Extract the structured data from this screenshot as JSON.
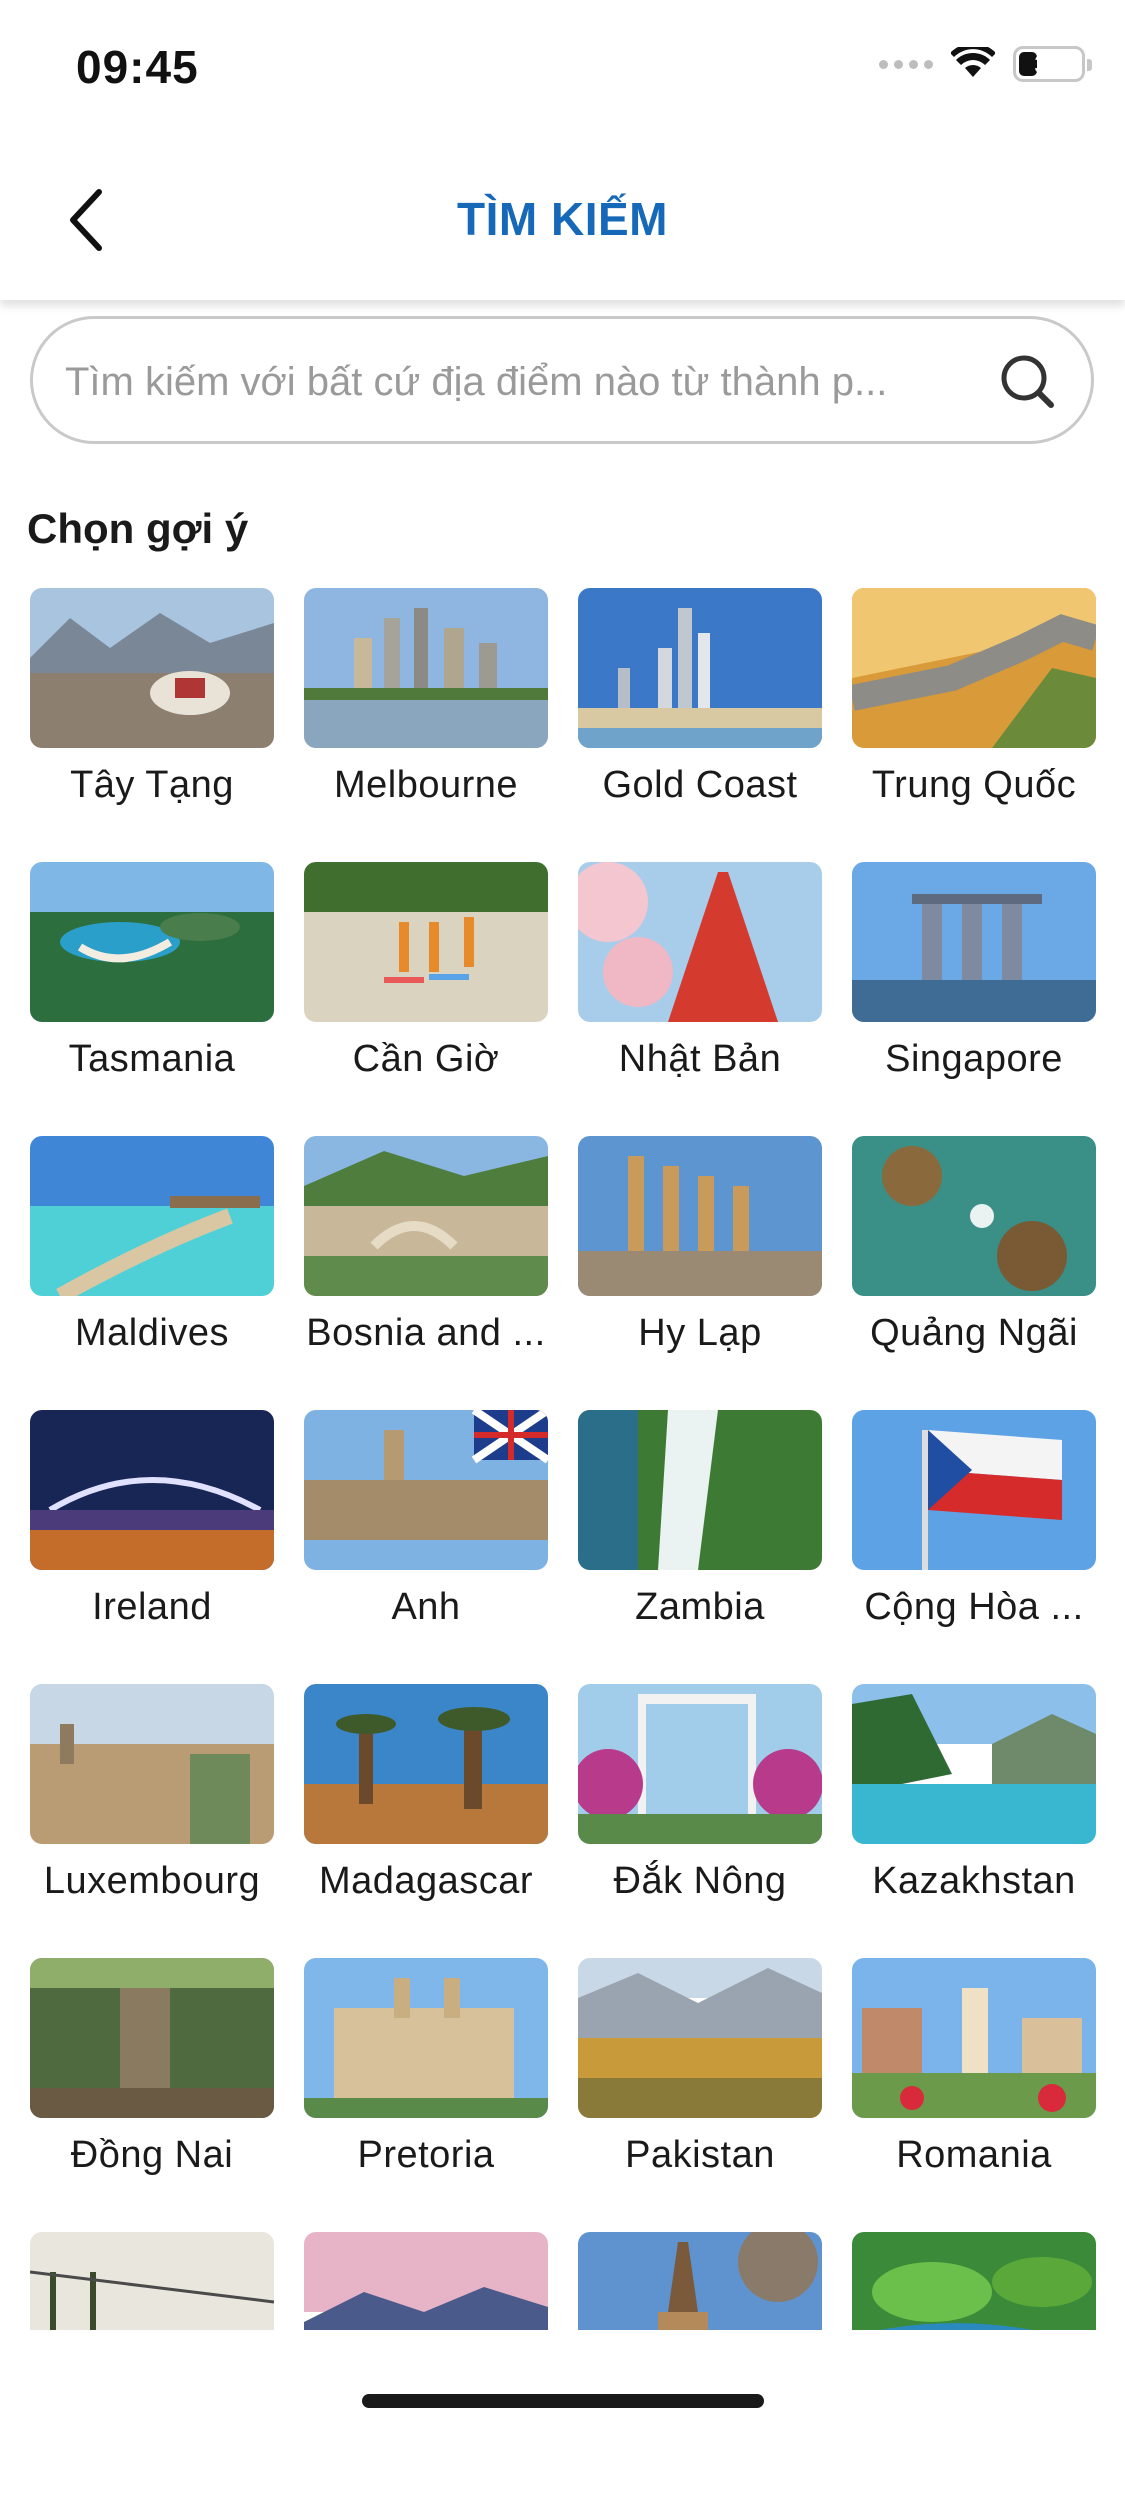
{
  "status_bar": {
    "time": "09:45",
    "battery_level": "31"
  },
  "header": {
    "title": "TÌM KIẾM",
    "back_icon": "chevron-left-icon"
  },
  "search": {
    "placeholder": "Tìm kiếm với bất cứ địa điểm nào từ thành p...",
    "value": "",
    "icon": "search-icon"
  },
  "suggestions": {
    "title": "Chọn gợi ý",
    "items": [
      {
        "label": "Tây Tạng"
      },
      {
        "label": "Melbourne"
      },
      {
        "label": "Gold Coast"
      },
      {
        "label": "Trung Quốc"
      },
      {
        "label": "Tasmania"
      },
      {
        "label": "Cần Giờ"
      },
      {
        "label": "Nhật Bản"
      },
      {
        "label": "Singapore"
      },
      {
        "label": "Maldives"
      },
      {
        "label": "Bosnia and ..."
      },
      {
        "label": "Hy Lạp"
      },
      {
        "label": "Quảng Ngãi"
      },
      {
        "label": "Ireland"
      },
      {
        "label": "Anh"
      },
      {
        "label": "Zambia"
      },
      {
        "label": "Cộng Hòa ..."
      },
      {
        "label": "Luxembourg"
      },
      {
        "label": "Madagascar"
      },
      {
        "label": "Đắk Nông"
      },
      {
        "label": "Kazakhstan"
      },
      {
        "label": "Đồng Nai"
      },
      {
        "label": "Pretoria"
      },
      {
        "label": "Pakistan"
      },
      {
        "label": "Romania"
      },
      {
        "label": ""
      },
      {
        "label": ""
      },
      {
        "label": ""
      },
      {
        "label": ""
      }
    ]
  },
  "colors": {
    "accent": "#1668b8",
    "border": "#c9c9c9"
  }
}
